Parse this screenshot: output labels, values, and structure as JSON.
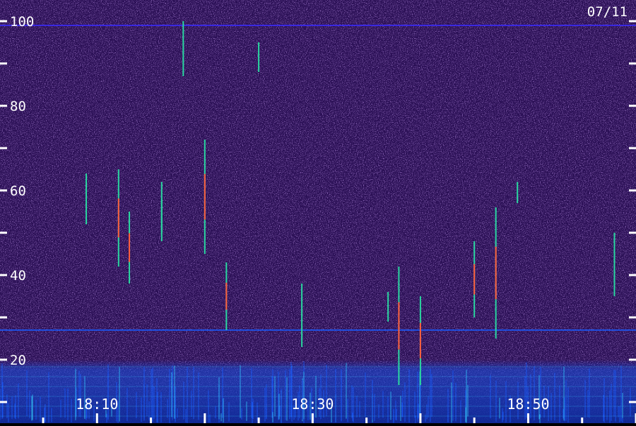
{
  "chart_data": {
    "type": "heatmap",
    "title": "",
    "date_label": "07/11",
    "xlabel": "",
    "ylabel": "",
    "x_ticks": [
      "18:10",
      "18:30",
      "18:50"
    ],
    "x_range": [
      "18:01",
      "19:00"
    ],
    "ylim": [
      0,
      100
    ],
    "y_tick_labels": [
      "100",
      "80",
      "60",
      "40",
      "20"
    ],
    "y_minor_ticks": [
      90,
      70,
      50,
      30,
      10
    ],
    "grid": false,
    "colors": {
      "background": "#2a0f55",
      "noise_light": "#6a3ab0",
      "low_band": "#1a5cff",
      "low_band_bright": "#33ccff",
      "mid": "#2ad6a0",
      "hot": "#ff5a3c",
      "axis": "#ffffff"
    },
    "meteor_echoes": [
      {
        "time": "18:09",
        "from": 52,
        "to": 64
      },
      {
        "time": "18:12",
        "from": 42,
        "to": 65
      },
      {
        "time": "18:13",
        "from": 38,
        "to": 55
      },
      {
        "time": "18:16",
        "from": 50,
        "to": 58
      },
      {
        "time": "18:16",
        "from": 48,
        "to": 62
      },
      {
        "time": "18:18",
        "from": 87,
        "to": 100
      },
      {
        "time": "18:20",
        "from": 45,
        "to": 72
      },
      {
        "time": "18:22",
        "from": 27,
        "to": 43
      },
      {
        "time": "18:25",
        "from": 88,
        "to": 95
      },
      {
        "time": "18:29",
        "from": 23,
        "to": 38
      },
      {
        "time": "18:37",
        "from": 29,
        "to": 36
      },
      {
        "time": "18:38",
        "from": 14,
        "to": 42
      },
      {
        "time": "18:40",
        "from": 14,
        "to": 35
      },
      {
        "time": "18:45",
        "from": 30,
        "to": 48
      },
      {
        "time": "18:47",
        "from": 25,
        "to": 56
      },
      {
        "time": "18:49",
        "from": 57,
        "to": 62
      },
      {
        "time": "18:58",
        "from": 35,
        "to": 50
      }
    ],
    "horizontal_lines": [
      {
        "value": 99,
        "color": "#3a2bff"
      },
      {
        "value": 27,
        "color": "#1a5cff"
      }
    ]
  }
}
